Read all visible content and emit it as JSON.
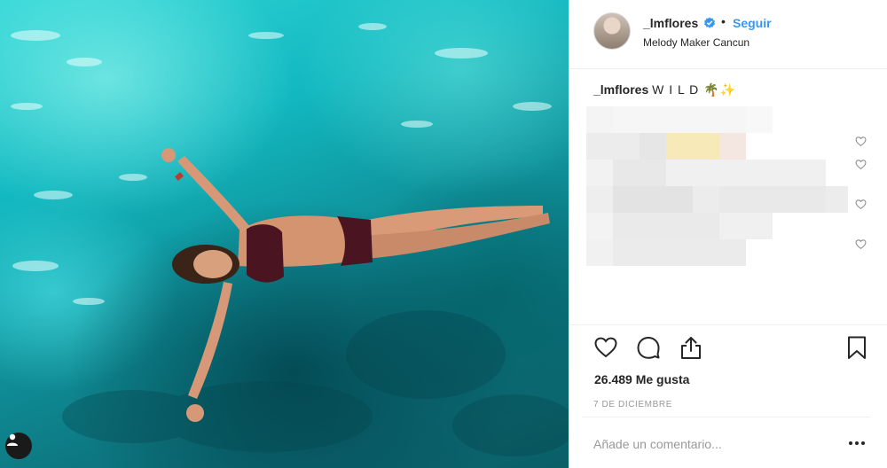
{
  "header": {
    "username": "_lmflores",
    "separator": "•",
    "follow_label": "Seguir",
    "location": "Melody Maker Cancun"
  },
  "caption": {
    "username": "_lmflores",
    "text": "W I L D 🌴✨"
  },
  "post": {
    "likes": "26.489 Me gusta",
    "date": "7 de diciembre"
  },
  "comment_box": {
    "placeholder": "Añade un comentario..."
  },
  "colors": {
    "follow_blue": "#3897f0",
    "verified_blue": "#3897f0",
    "text": "#262626",
    "muted": "#999999"
  },
  "icons": [
    "user-icon",
    "verified-badge-icon",
    "heart-icon",
    "comment-icon",
    "share-icon",
    "bookmark-icon",
    "more-options-icon"
  ]
}
